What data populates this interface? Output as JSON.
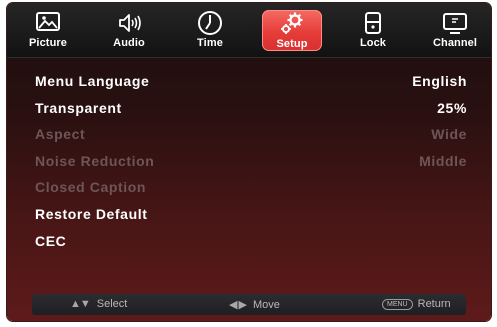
{
  "tabs": [
    {
      "label": "Picture",
      "icon": "picture-icon"
    },
    {
      "label": "Audio",
      "icon": "audio-icon"
    },
    {
      "label": "Time",
      "icon": "clock-icon"
    },
    {
      "label": "Setup",
      "icon": "gears-icon",
      "active": true
    },
    {
      "label": "Lock",
      "icon": "lock-icon"
    },
    {
      "label": "Channel",
      "icon": "tv-icon"
    }
  ],
  "menu": {
    "items": [
      {
        "label": "Menu Language",
        "value": "English",
        "enabled": true
      },
      {
        "label": "Transparent",
        "value": "25%",
        "enabled": true
      },
      {
        "label": "Aspect",
        "value": "Wide",
        "enabled": false
      },
      {
        "label": "Noise Reduction",
        "value": "Middle",
        "enabled": false
      },
      {
        "label": "Closed Caption",
        "value": "",
        "enabled": false
      },
      {
        "label": "Restore Default",
        "value": "",
        "enabled": true
      },
      {
        "label": "CEC",
        "value": "",
        "enabled": true
      }
    ]
  },
  "footer": {
    "select_glyph": "▲▼",
    "select_label": "Select",
    "move_glyph": "◀ ▶",
    "move_label": "Move",
    "menu_key": "MENU",
    "return_label": "Return"
  },
  "colors": {
    "active_tab": "#e63d39",
    "enabled_text": "#ffffff",
    "disabled_text": "#6e5656"
  }
}
